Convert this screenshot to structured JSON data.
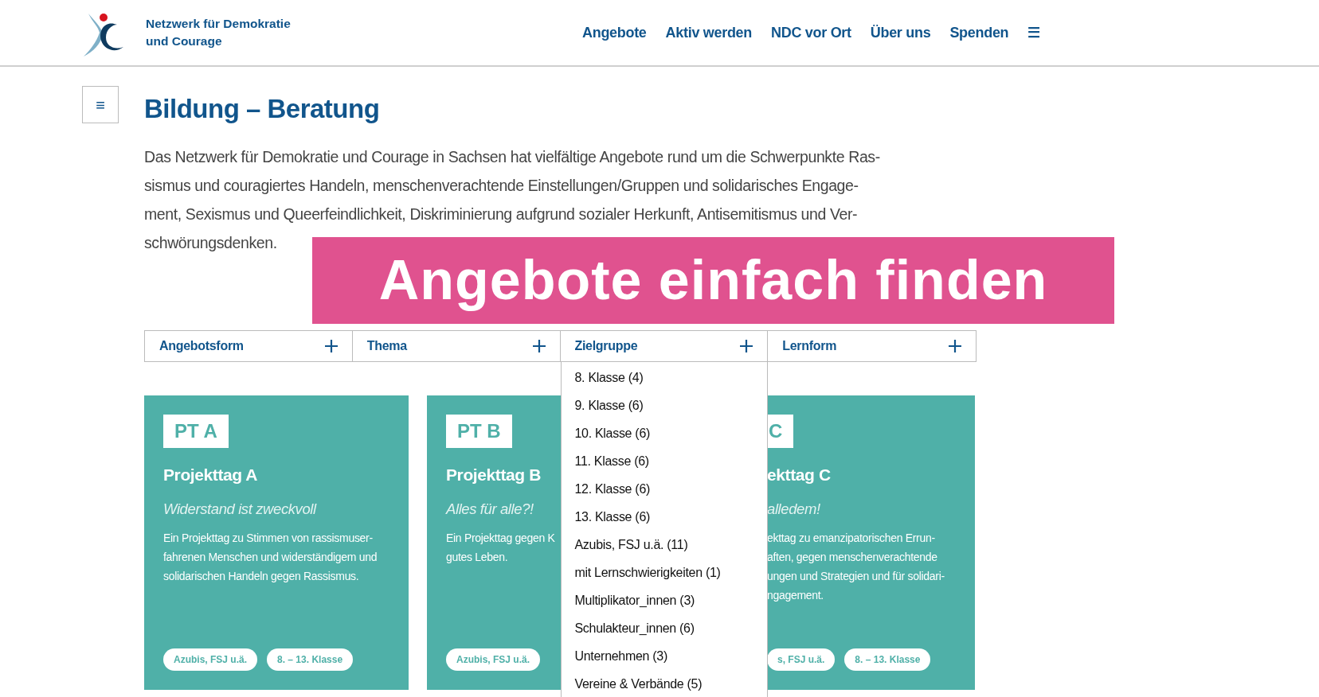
{
  "header": {
    "logo_text_lines": [
      "Netzwerk für Demokratie",
      "und Courage"
    ],
    "nav": [
      {
        "label": "Angebote"
      },
      {
        "label": "Aktiv werden"
      },
      {
        "label": "NDC vor Ort"
      },
      {
        "label": "Über uns"
      },
      {
        "label": "Spenden"
      },
      {
        "label": "☰"
      }
    ]
  },
  "sidebar_toggle": "≡",
  "page_title": "Bildung – Beratung",
  "intro_lines": [
    "Das Netzwerk für Demokratie und Courage in Sachsen hat vielfältige Angebote rund um die Schwerpunkte Ras-",
    "sismus und couragiertes Handeln, menschenverachtende Einstellungen/Gruppen und solidarisches Engage-",
    "ment, Sexismus und Queerfeindlichkeit, Diskriminierung aufgrund sozialer Herkunft, Antisemitismus und Ver-",
    "schwörungsdenken."
  ],
  "promo_banner": "Angebote einfach finden",
  "filters": [
    {
      "label": "Angebotsform"
    },
    {
      "label": "Thema"
    },
    {
      "label": "Zielgruppe",
      "options": [
        "8. Klasse (4)",
        "9. Klasse (6)",
        "10. Klasse (6)",
        "11. Klasse (6)",
        "12. Klasse (6)",
        "13. Klasse (6)",
        "Azubis, FSJ u.ä. (11)",
        "mit Lernschwierigkeiten (1)",
        "Multiplikator_innen (3)",
        "Schulakteur_innen (6)",
        "Unternehmen (3)",
        "Vereine & Verbände (5)"
      ]
    },
    {
      "label": "Lernform"
    }
  ],
  "cards": [
    {
      "kind": "full",
      "badge": "PT A",
      "title": "Projekttag A",
      "subtitle": "Widerstand ist zweckvoll",
      "lines": [
        "Ein Projekttag zu Stimmen von rassismuser-",
        "fahrenen Menschen und widerständigem und",
        "solidarischen Handeln gegen Rassismus."
      ],
      "tags": [
        "Azubis, FSJ u.ä.",
        "8. – 13. Klasse"
      ]
    },
    {
      "kind": "full",
      "badge": "PT B",
      "title": "Projekttag B",
      "subtitle": "Alles für alle?!",
      "lines": [
        "Ein Projekttag gegen K",
        "gutes Leben."
      ],
      "tags": [
        "Azubis, FSJ u.ä."
      ]
    },
    {
      "kind": "covered",
      "badge": "C",
      "title": "ekttag C",
      "subtitle": "alledem!",
      "lines": [
        "ekttag zu emanzipatorischen Errun-",
        "aften, gegen menschenverachtende",
        "ungen und Strategien und für solidari-",
        "ngagement."
      ],
      "tags": [
        "s, FSJ u.ä.",
        "8. – 13. Klasse"
      ]
    }
  ]
}
